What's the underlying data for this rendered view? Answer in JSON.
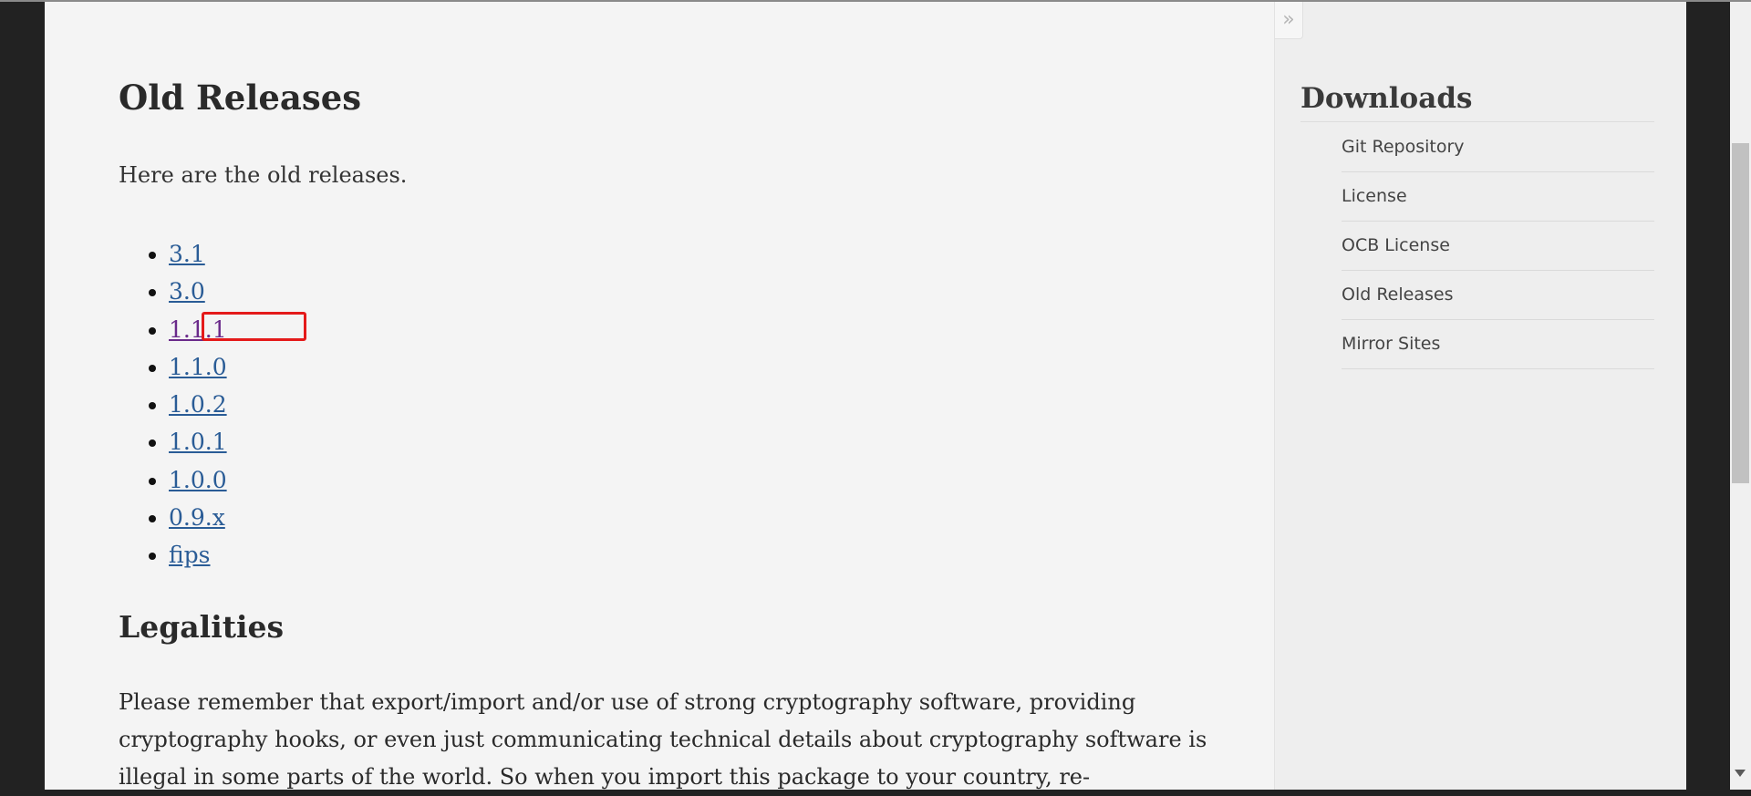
{
  "main": {
    "title": "Old Releases",
    "intro": "Here are the old releases.",
    "releases": [
      "3.1",
      "3.0",
      "1.1.1",
      "1.1.0",
      "1.0.2",
      "1.0.1",
      "1.0.0",
      "0.9.x",
      "fips"
    ],
    "legal_heading": "Legalities",
    "legal_text": "Please remember that export/import and/or use of strong cryptography software, providing cryptography hooks, or even just communicating technical details about cryptography software is illegal in some parts of the world. So when you import this package to your country, re-"
  },
  "sidebar": {
    "toggle_icon": "double-chevron-right-icon",
    "toggle_glyph": "»",
    "heading": "Downloads",
    "links": [
      "Git Repository",
      "License",
      "OCB License",
      "Old Releases",
      "Mirror Sites"
    ]
  },
  "colors": {
    "link": "#2a5c96",
    "visited_link": "#6a2a8a",
    "highlight": "#e41a1a"
  }
}
